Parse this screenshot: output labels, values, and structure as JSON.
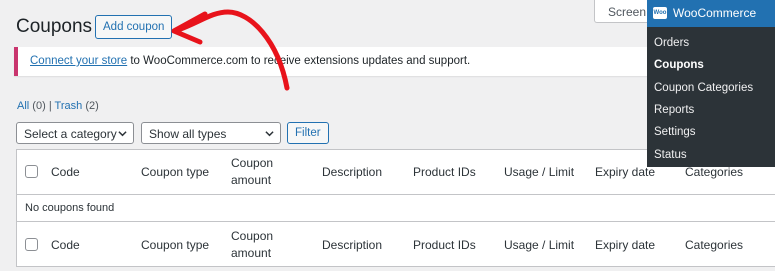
{
  "header": {
    "screen_options": "Screen Options",
    "title": "Coupons",
    "add_button": "Add coupon"
  },
  "notice": {
    "link_text": "Connect your store",
    "rest_text": " to WooCommerce.com to receive extensions updates and support."
  },
  "views": {
    "all_label": "All",
    "all_count": "(0)",
    "separator": "|",
    "trash_label": "Trash",
    "trash_count": "(2)"
  },
  "filters": {
    "category_select": "Select a category",
    "type_select": "Show all types",
    "filter_button": "Filter"
  },
  "table": {
    "columns": [
      "Code",
      "Coupon type",
      "Coupon amount",
      "Description",
      "Product IDs",
      "Usage / Limit",
      "Expiry date",
      "Categories"
    ],
    "column_lines": {
      "coupon_amount_1": "Coupon",
      "coupon_amount_2": "amount"
    },
    "empty_message": "No coupons found"
  },
  "woocommerce_menu": {
    "logo_text": "Woo",
    "title": "WooCommerce",
    "items": [
      "Orders",
      "Coupons",
      "Coupon Categories",
      "Reports",
      "Settings",
      "Status"
    ],
    "current": "Coupons"
  },
  "colors": {
    "accent": "#2271b1",
    "menu_bg": "#2c3338",
    "notice_border": "#c9356e",
    "annotation_arrow": "#e8131b"
  }
}
